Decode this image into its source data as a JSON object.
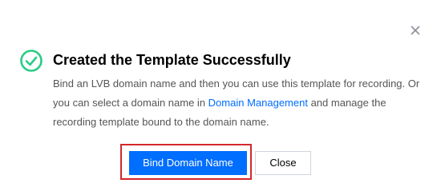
{
  "dialog": {
    "title": "Created the Template Successfully",
    "description": {
      "part1": "Bind an LVB domain name and then you can use this template for recording. Or you can select a domain name in ",
      "link": "Domain Management",
      "part2": " and manage the recording template bound to the domain name."
    },
    "buttons": {
      "primary": "Bind Domain Name",
      "secondary": "Close"
    },
    "icons": {
      "status": "success-check-circle-icon",
      "close": "close-icon"
    },
    "colors": {
      "success": "#29cc85",
      "primary": "#006eff",
      "highlight": "#d4272d"
    }
  }
}
